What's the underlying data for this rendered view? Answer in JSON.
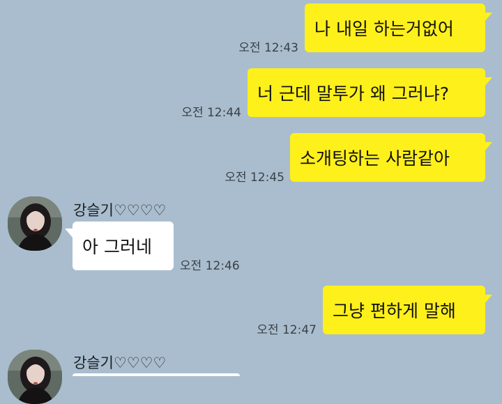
{
  "messages": [
    {
      "sender": "me",
      "text": "나 내일 하는거없어",
      "time": "오전 12:43"
    },
    {
      "sender": "me",
      "text": "너 근데 말투가 왜 그러냐?",
      "time": "오전 12:44"
    },
    {
      "sender": "me",
      "text": "소개팅하는 사람같아",
      "time": "오전 12:45"
    },
    {
      "sender": "other",
      "name": "강슬기♡♡♡♡",
      "text": "아 그러네",
      "time": "오전 12:46"
    },
    {
      "sender": "me",
      "text": "그냥 편하게 말해",
      "time": "오전 12:47"
    },
    {
      "sender": "other",
      "name": "강슬기♡♡♡♡",
      "text": "",
      "time": ""
    }
  ],
  "colors": {
    "background": "#a9bdce",
    "my_bubble": "#fef01b",
    "other_bubble": "#ffffff"
  }
}
